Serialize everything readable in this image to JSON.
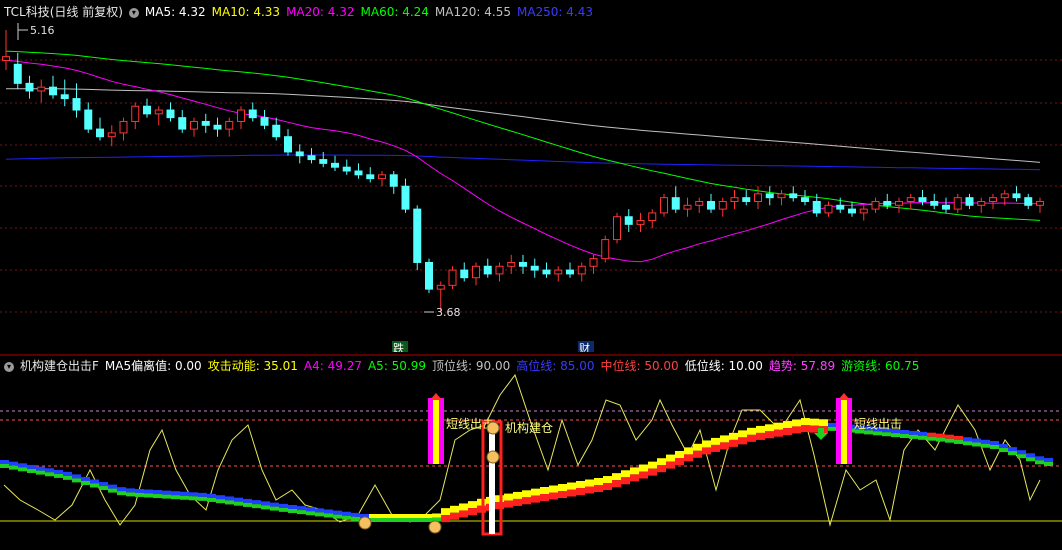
{
  "main": {
    "header": {
      "title": "TCL科技(日线 前复权)",
      "ma5": "MA5: 4.32",
      "ma10": "MA10: 4.33",
      "ma20": "MA20: 4.32",
      "ma60": "MA60: 4.24",
      "ma120": "MA120: 4.55",
      "ma250": "MA250: 4.43"
    },
    "high_label": "5.16",
    "low_label": "3.68",
    "markers": [
      "跌",
      "财"
    ]
  },
  "indicator": {
    "header": {
      "name": "机构建仓出击F",
      "ma5dev": "MA5偏离值: 0.00",
      "attack": "攻击动能: 35.01",
      "a4": "A4: 49.27",
      "a5": "A5: 50.99",
      "top": "顶位线: 90.00",
      "high": "高位线: 85.00",
      "mid": "中位线: 50.00",
      "low": "低位线: 10.00",
      "trend": "趋势: 57.89",
      "hot": "游资线: 60.75"
    },
    "signals": [
      "短线出击",
      "机构建仓",
      "短线出击"
    ]
  },
  "colors": {
    "up": "#ff3333",
    "down": "#54ffff",
    "ma5": "#ffffff",
    "ma10": "#ffff00",
    "ma20": "#ff00ff",
    "ma60": "#00ff00",
    "ma120": "#c0c0c0",
    "ma250": "#2020ff"
  },
  "chart_data": {
    "type": "candlestick",
    "y_axis_hint": [
      3.68,
      5.16
    ],
    "ohlc": [
      [
        5.0,
        5.16,
        4.95,
        5.02
      ],
      [
        4.98,
        5.04,
        4.85,
        4.88
      ],
      [
        4.88,
        4.92,
        4.8,
        4.84
      ],
      [
        4.84,
        4.9,
        4.78,
        4.86
      ],
      [
        4.86,
        4.92,
        4.8,
        4.82
      ],
      [
        4.82,
        4.9,
        4.76,
        4.8
      ],
      [
        4.8,
        4.88,
        4.7,
        4.74
      ],
      [
        4.74,
        4.78,
        4.62,
        4.64
      ],
      [
        4.64,
        4.7,
        4.58,
        4.6
      ],
      [
        4.6,
        4.66,
        4.55,
        4.62
      ],
      [
        4.62,
        4.7,
        4.58,
        4.68
      ],
      [
        4.68,
        4.78,
        4.64,
        4.76
      ],
      [
        4.76,
        4.8,
        4.7,
        4.72
      ],
      [
        4.72,
        4.76,
        4.66,
        4.74
      ],
      [
        4.74,
        4.78,
        4.68,
        4.7
      ],
      [
        4.7,
        4.74,
        4.62,
        4.64
      ],
      [
        4.64,
        4.7,
        4.6,
        4.68
      ],
      [
        4.68,
        4.72,
        4.62,
        4.66
      ],
      [
        4.66,
        4.7,
        4.6,
        4.64
      ],
      [
        4.64,
        4.7,
        4.6,
        4.68
      ],
      [
        4.68,
        4.76,
        4.64,
        4.74
      ],
      [
        4.74,
        4.78,
        4.68,
        4.7
      ],
      [
        4.7,
        4.74,
        4.64,
        4.66
      ],
      [
        4.66,
        4.7,
        4.58,
        4.6
      ],
      [
        4.6,
        4.64,
        4.5,
        4.52
      ],
      [
        4.52,
        4.56,
        4.46,
        4.5
      ],
      [
        4.5,
        4.54,
        4.46,
        4.48
      ],
      [
        4.48,
        4.52,
        4.44,
        4.46
      ],
      [
        4.46,
        4.5,
        4.42,
        4.44
      ],
      [
        4.44,
        4.48,
        4.4,
        4.42
      ],
      [
        4.42,
        4.46,
        4.38,
        4.4
      ],
      [
        4.4,
        4.44,
        4.36,
        4.38
      ],
      [
        4.38,
        4.42,
        4.34,
        4.4
      ],
      [
        4.4,
        4.42,
        4.3,
        4.34
      ],
      [
        4.34,
        4.38,
        4.2,
        4.22
      ],
      [
        4.22,
        4.24,
        3.9,
        3.94
      ],
      [
        3.94,
        3.96,
        3.78,
        3.8
      ],
      [
        3.8,
        3.84,
        3.68,
        3.82
      ],
      [
        3.82,
        3.92,
        3.8,
        3.9
      ],
      [
        3.9,
        3.94,
        3.84,
        3.86
      ],
      [
        3.86,
        3.94,
        3.82,
        3.92
      ],
      [
        3.92,
        3.96,
        3.86,
        3.88
      ],
      [
        3.88,
        3.94,
        3.84,
        3.92
      ],
      [
        3.92,
        3.98,
        3.88,
        3.94
      ],
      [
        3.94,
        3.98,
        3.88,
        3.92
      ],
      [
        3.92,
        3.96,
        3.86,
        3.9
      ],
      [
        3.9,
        3.94,
        3.86,
        3.88
      ],
      [
        3.88,
        3.92,
        3.84,
        3.9
      ],
      [
        3.9,
        3.94,
        3.86,
        3.88
      ],
      [
        3.88,
        3.94,
        3.84,
        3.92
      ],
      [
        3.92,
        3.98,
        3.88,
        3.96
      ],
      [
        3.96,
        4.08,
        3.94,
        4.06
      ],
      [
        4.06,
        4.2,
        4.04,
        4.18
      ],
      [
        4.18,
        4.22,
        4.1,
        4.14
      ],
      [
        4.14,
        4.2,
        4.1,
        4.16
      ],
      [
        4.16,
        4.22,
        4.12,
        4.2
      ],
      [
        4.2,
        4.3,
        4.18,
        4.28
      ],
      [
        4.28,
        4.34,
        4.2,
        4.22
      ],
      [
        4.22,
        4.28,
        4.18,
        4.24
      ],
      [
        4.24,
        4.28,
        4.2,
        4.26
      ],
      [
        4.26,
        4.3,
        4.2,
        4.22
      ],
      [
        4.22,
        4.28,
        4.18,
        4.26
      ],
      [
        4.26,
        4.32,
        4.22,
        4.28
      ],
      [
        4.28,
        4.32,
        4.24,
        4.26
      ],
      [
        4.26,
        4.34,
        4.22,
        4.3
      ],
      [
        4.3,
        4.34,
        4.24,
        4.28
      ],
      [
        4.28,
        4.32,
        4.24,
        4.3
      ],
      [
        4.3,
        4.34,
        4.26,
        4.28
      ],
      [
        4.28,
        4.32,
        4.24,
        4.26
      ],
      [
        4.26,
        4.3,
        4.18,
        4.2
      ],
      [
        4.2,
        4.26,
        4.18,
        4.24
      ],
      [
        4.24,
        4.28,
        4.2,
        4.22
      ],
      [
        4.22,
        4.26,
        4.18,
        4.2
      ],
      [
        4.2,
        4.24,
        4.16,
        4.22
      ],
      [
        4.22,
        4.28,
        4.2,
        4.26
      ],
      [
        4.26,
        4.3,
        4.22,
        4.24
      ],
      [
        4.24,
        4.28,
        4.2,
        4.26
      ],
      [
        4.26,
        4.3,
        4.22,
        4.28
      ],
      [
        4.28,
        4.32,
        4.24,
        4.26
      ],
      [
        4.26,
        4.3,
        4.22,
        4.24
      ],
      [
        4.24,
        4.28,
        4.2,
        4.22
      ],
      [
        4.22,
        4.3,
        4.2,
        4.28
      ],
      [
        4.28,
        4.3,
        4.22,
        4.24
      ],
      [
        4.24,
        4.28,
        4.2,
        4.26
      ],
      [
        4.26,
        4.3,
        4.22,
        4.28
      ],
      [
        4.28,
        4.32,
        4.24,
        4.3
      ],
      [
        4.3,
        4.34,
        4.26,
        4.28
      ],
      [
        4.28,
        4.3,
        4.22,
        4.24
      ],
      [
        4.24,
        4.28,
        4.2,
        4.26
      ]
    ]
  }
}
